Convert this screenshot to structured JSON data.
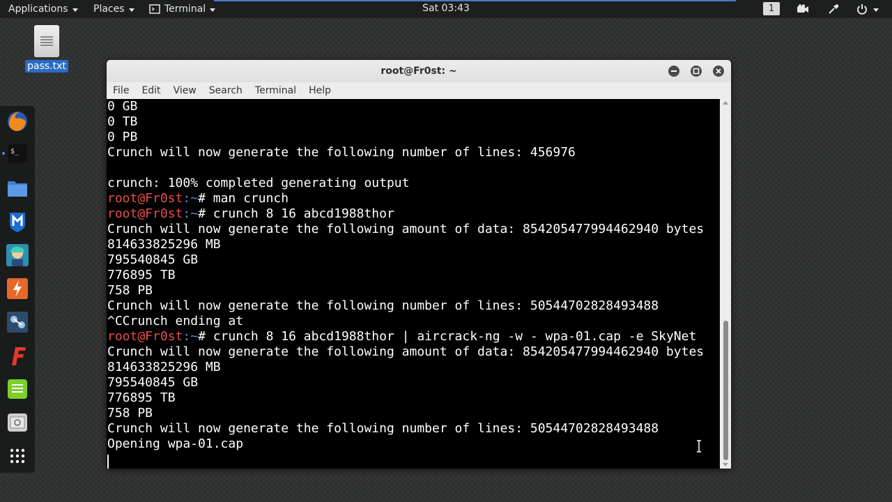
{
  "topbar": {
    "applications": "Applications",
    "places": "Places",
    "terminal": "Terminal",
    "clock": "Sat 03:43",
    "workspace": "1"
  },
  "desktop": {
    "file_label": "pass.txt"
  },
  "dock": {
    "items": [
      "firefox-icon",
      "terminal-icon",
      "files-icon",
      "metasploit-icon",
      "armitage-icon",
      "burpsuite-icon",
      "maltego-icon",
      "faraday-icon",
      "leafpad-icon",
      "screenshot-icon",
      "show-apps-icon"
    ]
  },
  "window": {
    "title": "root@Fr0st: ~",
    "menu": [
      "File",
      "Edit",
      "View",
      "Search",
      "Terminal",
      "Help"
    ]
  },
  "terminal": {
    "lines": [
      {
        "text": "0 GB"
      },
      {
        "text": "0 TB"
      },
      {
        "text": "0 PB"
      },
      {
        "text": "Crunch will now generate the following number of lines: 456976"
      },
      {
        "text": ""
      },
      {
        "text": "crunch: 100% completed generating output"
      },
      {
        "user": "root@Fr0st",
        "path": ":~",
        "text": "# man crunch"
      },
      {
        "user": "root@Fr0st",
        "path": ":~",
        "text": "# crunch 8 16 abcd1988thor"
      },
      {
        "text": "Crunch will now generate the following amount of data: 854205477994462940 bytes"
      },
      {
        "text": "814633825296 MB"
      },
      {
        "text": "795540845 GB"
      },
      {
        "text": "776895 TB"
      },
      {
        "text": "758 PB"
      },
      {
        "text": "Crunch will now generate the following number of lines: 50544702828493488"
      },
      {
        "text": "^CCrunch ending at"
      },
      {
        "user": "root@Fr0st",
        "path": ":~",
        "text": "# crunch 8 16 abcd1988thor | aircrack-ng -w - wpa-01.cap -e SkyNet"
      },
      {
        "text": "Crunch will now generate the following amount of data: 854205477994462940 bytes"
      },
      {
        "text": "814633825296 MB"
      },
      {
        "text": "795540845 GB"
      },
      {
        "text": "776895 TB"
      },
      {
        "text": "758 PB"
      },
      {
        "text": "Crunch will now generate the following number of lines: 50544702828493488"
      },
      {
        "text": "Opening wpa-01.cap"
      }
    ]
  }
}
